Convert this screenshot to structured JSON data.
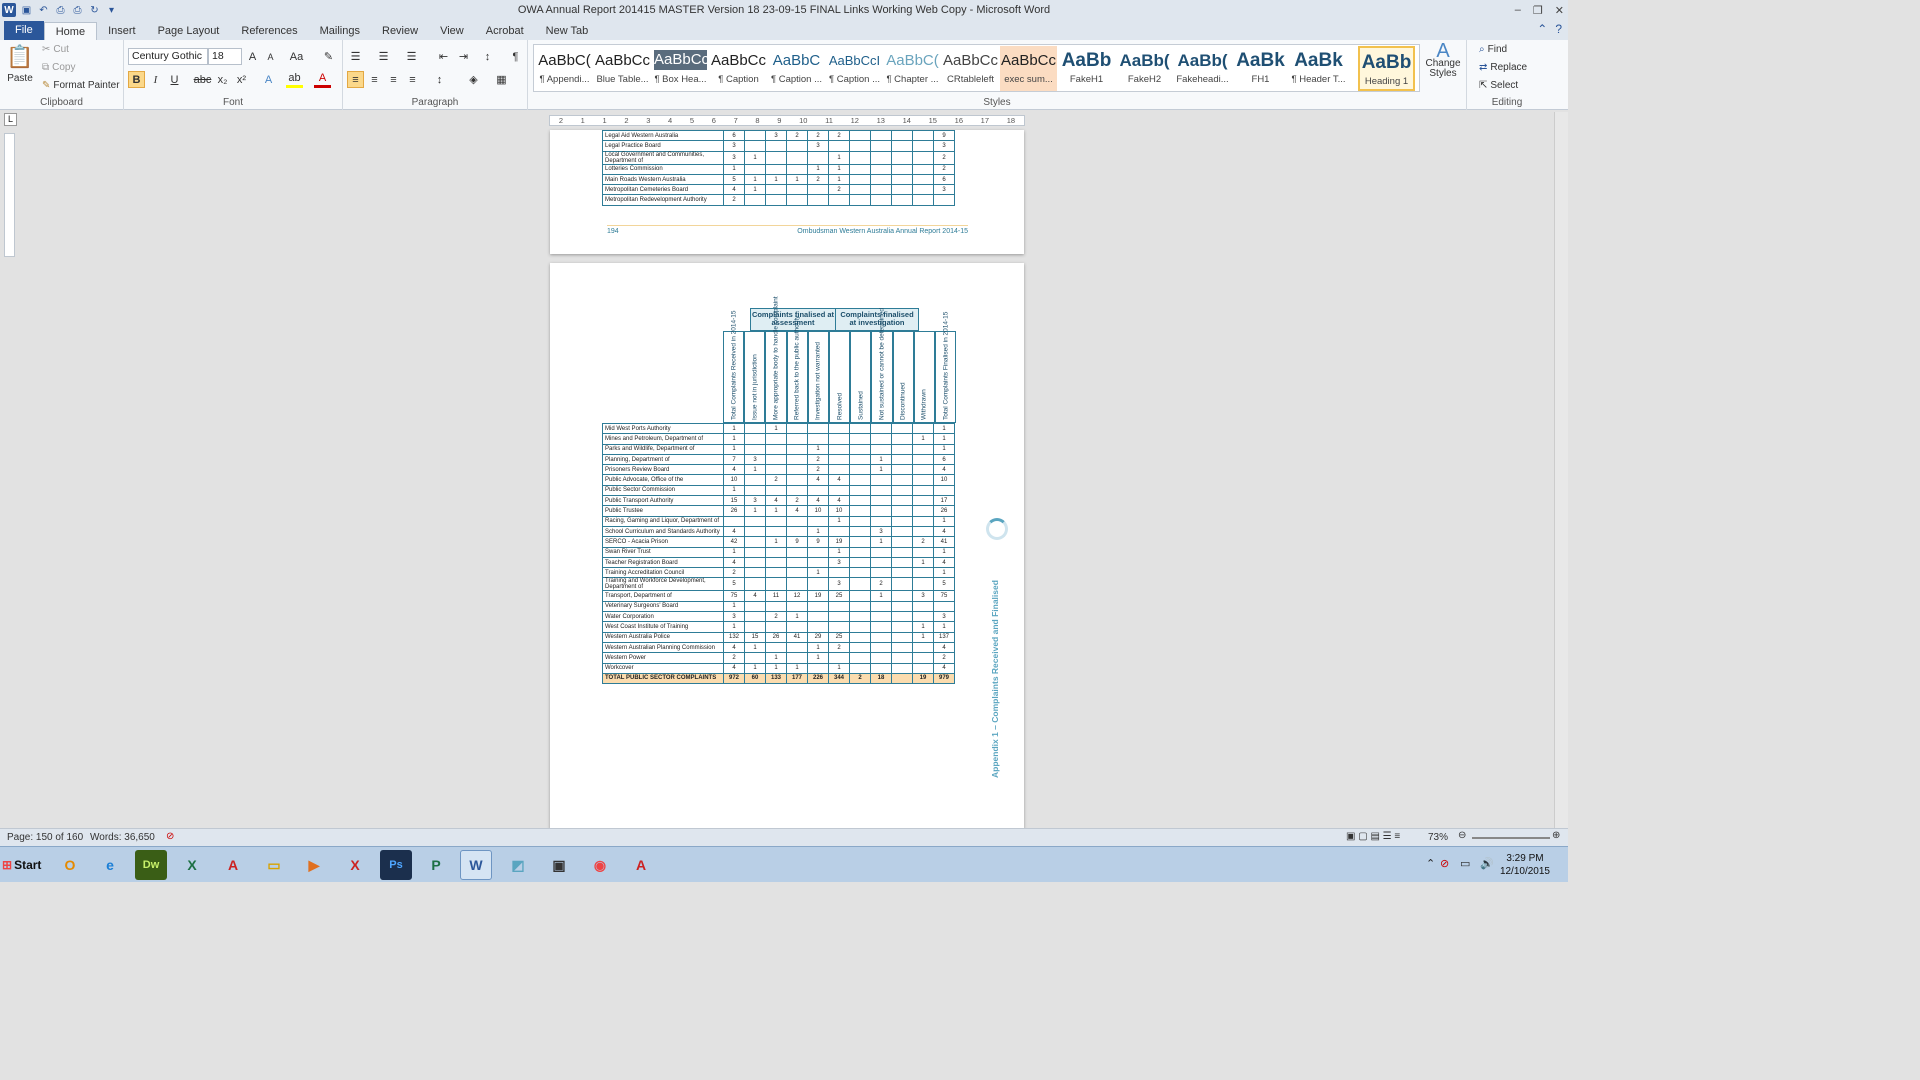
{
  "window": {
    "title": "OWA Annual Report 201415 MASTER Version 18 23-09-15 FINAL Links Working Web Copy - Microsoft Word"
  },
  "tabs": [
    "File",
    "Home",
    "Insert",
    "Page Layout",
    "References",
    "Mailings",
    "Review",
    "View",
    "Acrobat",
    "New Tab"
  ],
  "clipboard": {
    "paste": "Paste",
    "cut": "Cut",
    "copy": "Copy",
    "format_painter": "Format Painter",
    "label": "Clipboard"
  },
  "font": {
    "name": "Century Gothic",
    "size": "18",
    "label": "Font"
  },
  "paragraph": {
    "label": "Paragraph"
  },
  "styles": {
    "label": "Styles",
    "items": [
      {
        "preview": "AaBbC(",
        "name": "¶ Appendi..."
      },
      {
        "preview": "AaBbCc",
        "name": "Blue Table..."
      },
      {
        "preview": "AaBbCc",
        "name": "¶ Box Hea..."
      },
      {
        "preview": "AaBbCc",
        "name": "¶ Caption"
      },
      {
        "preview": "AaBbC",
        "name": "¶ Caption ..."
      },
      {
        "preview": "AaBbCcI",
        "name": "¶ Caption ..."
      },
      {
        "preview": "AaBbC(",
        "name": "¶ Chapter ..."
      },
      {
        "preview": "AaBbCc",
        "name": "CRtableleft"
      },
      {
        "preview": "AaBbCc",
        "name": "exec sum..."
      },
      {
        "preview": "AaBb",
        "name": "FakeH1"
      },
      {
        "preview": "AaBb(",
        "name": "FakeH2"
      },
      {
        "preview": "AaBb(",
        "name": "Fakeheadi..."
      },
      {
        "preview": "AaBk",
        "name": "FH1"
      },
      {
        "preview": "AaBk",
        "name": "¶ Header T..."
      },
      {
        "preview": "AaBb",
        "name": "Heading 1"
      }
    ],
    "change": "Change Styles"
  },
  "editing": {
    "find": "Find",
    "replace": "Replace",
    "select": "Select",
    "label": "Editing"
  },
  "ruler": [
    "2",
    "1",
    "1",
    "2",
    "3",
    "4",
    "5",
    "6",
    "7",
    "8",
    "9",
    "10",
    "11",
    "12",
    "13",
    "14",
    "15",
    "16",
    "17",
    "18"
  ],
  "page1": {
    "rows": [
      {
        "name": "Legal Aid Western Australia",
        "v": [
          "6",
          "",
          "3",
          "2",
          "2",
          "2",
          "",
          "",
          "",
          "",
          "9"
        ]
      },
      {
        "name": "Legal Practice Board",
        "v": [
          "3",
          "",
          "",
          "",
          "3",
          "",
          "",
          "",
          "",
          "",
          "3"
        ]
      },
      {
        "name": "Local Government and Communities, Department of",
        "v": [
          "3",
          "1",
          "",
          "",
          "",
          "1",
          "",
          "",
          "",
          "",
          "2"
        ]
      },
      {
        "name": "Lotteries Commission",
        "v": [
          "1",
          "",
          "",
          "",
          "1",
          "1",
          "",
          "",
          "",
          "",
          "2"
        ]
      },
      {
        "name": "Main Roads Western Australia",
        "v": [
          "5",
          "1",
          "1",
          "1",
          "2",
          "1",
          "",
          "",
          "",
          "",
          "6"
        ]
      },
      {
        "name": "Metropolitan Cemeteries Board",
        "v": [
          "4",
          "1",
          "",
          "",
          "",
          "2",
          "",
          "",
          "",
          "",
          "3"
        ]
      },
      {
        "name": "Metropolitan Redevelopment Authority",
        "v": [
          "2",
          "",
          "",
          "",
          "",
          "",
          "",
          "",
          "",
          "",
          ""
        ]
      }
    ],
    "footer_page": "194",
    "footer_title": "Ombudsman Western Australia Annual Report 2014-15"
  },
  "page2": {
    "group1": "Complaints finalised at assessment",
    "group2": "Complaints finalised at investigation",
    "columns": [
      "Total Complaints Received in 2014-15",
      "Issue not in jurisdiction",
      "More appropriate body to handle complaint",
      "Referred back to the public authority",
      "Investigation not warranted",
      "Resolved",
      "Sustained",
      "Not sustained or cannot be determined",
      "Discontinued",
      "Withdrawn",
      "Total Complaints Finalised in 2014-15"
    ],
    "rows": [
      {
        "name": "Mid West Ports Authority",
        "v": [
          "1",
          "",
          "1",
          "",
          "",
          "",
          "",
          "",
          "",
          "",
          "1"
        ]
      },
      {
        "name": "Mines and Petroleum, Department of",
        "v": [
          "1",
          "",
          "",
          "",
          "",
          "",
          "",
          "",
          "",
          "1",
          "1"
        ]
      },
      {
        "name": "Parks and Wildlife, Department of",
        "v": [
          "1",
          "",
          "",
          "",
          "1",
          "",
          "",
          "",
          "",
          "",
          "1"
        ]
      },
      {
        "name": "Planning, Department of",
        "v": [
          "7",
          "3",
          "",
          "",
          "2",
          "",
          "",
          "1",
          "",
          "",
          "6"
        ]
      },
      {
        "name": "Prisoners Review Board",
        "v": [
          "4",
          "1",
          "",
          "",
          "2",
          "",
          "",
          "1",
          "",
          "",
          "4"
        ]
      },
      {
        "name": "Public Advocate, Office of the",
        "v": [
          "10",
          "",
          "2",
          "",
          "4",
          "4",
          "",
          "",
          "",
          "",
          "10"
        ]
      },
      {
        "name": "Public Sector Commission",
        "v": [
          "1",
          "",
          "",
          "",
          "",
          "",
          "",
          "",
          "",
          "",
          ""
        ]
      },
      {
        "name": "Public Transport Authority",
        "v": [
          "15",
          "3",
          "4",
          "2",
          "4",
          "4",
          "",
          "",
          "",
          "",
          "17"
        ]
      },
      {
        "name": "Public Trustee",
        "v": [
          "26",
          "1",
          "1",
          "4",
          "10",
          "10",
          "",
          "",
          "",
          "",
          "26"
        ]
      },
      {
        "name": "Racing, Gaming and Liquor, Department of",
        "v": [
          "",
          "",
          "",
          "",
          "",
          "1",
          "",
          "",
          "",
          "",
          "1"
        ]
      },
      {
        "name": "School Curriculum and Standards Authority",
        "v": [
          "4",
          "",
          "",
          "",
          "1",
          "",
          "",
          "3",
          "",
          "",
          "4"
        ]
      },
      {
        "name": "SERCO - Acacia Prison",
        "v": [
          "42",
          "",
          "1",
          "9",
          "9",
          "19",
          "",
          "1",
          "",
          "2",
          "41"
        ]
      },
      {
        "name": "Swan River Trust",
        "v": [
          "1",
          "",
          "",
          "",
          "",
          "1",
          "",
          "",
          "",
          "",
          "1"
        ]
      },
      {
        "name": "Teacher Registration Board",
        "v": [
          "4",
          "",
          "",
          "",
          "",
          "3",
          "",
          "",
          "",
          "1",
          "4"
        ]
      },
      {
        "name": "Training Accreditation Council",
        "v": [
          "2",
          "",
          "",
          "",
          "1",
          "",
          "",
          "",
          "",
          "",
          "1"
        ]
      },
      {
        "name": "Training and Workforce Development, Department of",
        "v": [
          "5",
          "",
          "",
          "",
          "",
          "3",
          "",
          "2",
          "",
          "",
          "5"
        ]
      },
      {
        "name": "Transport, Department of",
        "v": [
          "75",
          "4",
          "11",
          "12",
          "19",
          "25",
          "",
          "1",
          "",
          "3",
          "75"
        ]
      },
      {
        "name": "Veterinary Surgeons' Board",
        "v": [
          "1",
          "",
          "",
          "",
          "",
          "",
          "",
          "",
          "",
          "",
          ""
        ]
      },
      {
        "name": "Water Corporation",
        "v": [
          "3",
          "",
          "2",
          "1",
          "",
          "",
          "",
          "",
          "",
          "",
          "3"
        ]
      },
      {
        "name": "West Coast Institute of Training",
        "v": [
          "1",
          "",
          "",
          "",
          "",
          "",
          "",
          "",
          "",
          "1",
          "1"
        ]
      },
      {
        "name": "Western Australia Police",
        "v": [
          "132",
          "15",
          "26",
          "41",
          "29",
          "25",
          "",
          "",
          "",
          "1",
          "137"
        ]
      },
      {
        "name": "Western Australian Planning Commission",
        "v": [
          "4",
          "1",
          "",
          "",
          "1",
          "2",
          "",
          "",
          "",
          "",
          "4"
        ]
      },
      {
        "name": "Western Power",
        "v": [
          "2",
          "",
          "1",
          "",
          "1",
          "",
          "",
          "",
          "",
          "",
          "2"
        ]
      },
      {
        "name": "Workcover",
        "v": [
          "4",
          "1",
          "1",
          "1",
          "",
          "1",
          "",
          "",
          "",
          "",
          "4"
        ]
      }
    ],
    "total": {
      "name": "TOTAL PUBLIC SECTOR COMPLAINTS",
      "v": [
        "972",
        "60",
        "133",
        "177",
        "226",
        "344",
        "2",
        "18",
        "",
        "19",
        "979"
      ]
    },
    "side_text": "Appendix 1 – Complaints Received and Finalised"
  },
  "status": {
    "page": "Page: 150 of 160",
    "words": "Words: 36,650",
    "zoom": "73%"
  },
  "clock": {
    "time": "3:29 PM",
    "date": "12/10/2015"
  },
  "taskbar": {
    "start": "Start"
  },
  "colors": {
    "accent": "#2b579a",
    "table_border": "#2e7c97",
    "total_row": "#fbdcae",
    "header_fill": "#dfeef3"
  }
}
